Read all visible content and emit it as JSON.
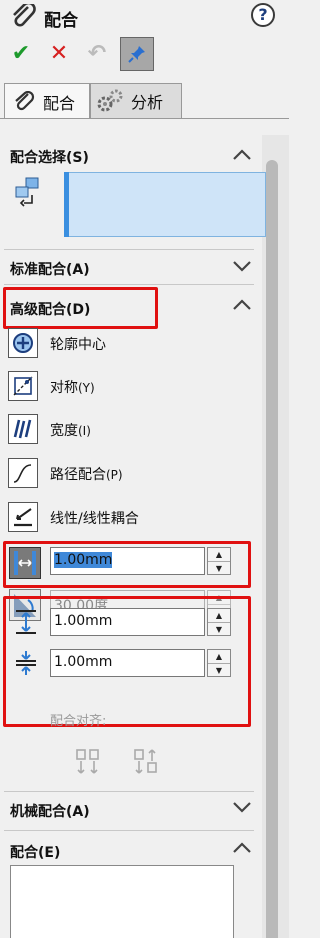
{
  "header": {
    "title": "配合",
    "help_label": "?"
  },
  "toolbar": {
    "ok_glyph": "✔",
    "cancel_glyph": "✕",
    "undo_glyph": "↶",
    "pin_glyph": "📌"
  },
  "tabs": [
    {
      "label": "配合",
      "active": true
    },
    {
      "label": "分析",
      "active": false
    }
  ],
  "sections": {
    "selection": {
      "title": "配合选择(S)"
    },
    "standard": {
      "title": "标准配合(A)"
    },
    "advanced": {
      "title": "高级配合(D)",
      "options": [
        {
          "label": "轮廓中心",
          "icon": "profile-center-icon"
        },
        {
          "label": "对称",
          "suffix": "(Y)",
          "icon": "symmetric-icon"
        },
        {
          "label": "宽度",
          "suffix": "(I)",
          "icon": "width-icon"
        },
        {
          "label": "路径配合",
          "suffix": "(P)",
          "icon": "path-mate-icon"
        },
        {
          "label": "线性/线性耦合",
          "icon": "linear-coupler-icon"
        }
      ],
      "distance_value": "1.00mm",
      "angle_value": "30.00度",
      "max_value": "1.00mm",
      "min_value": "1.00mm",
      "alignment_label": "配合对齐:"
    },
    "mechanical": {
      "title": "机械配合(A)"
    },
    "mates": {
      "title": "配合(E)"
    }
  },
  "colors": {
    "highlight": "#e01010",
    "ok": "#1d9a2c",
    "cancel": "#d62020",
    "selection_bg": "#cfe4f8"
  }
}
